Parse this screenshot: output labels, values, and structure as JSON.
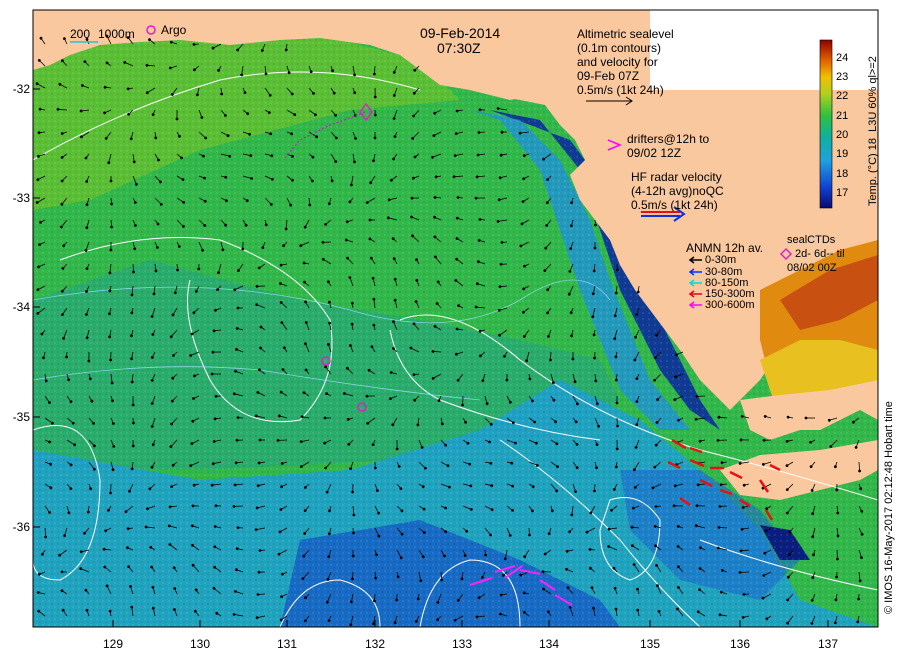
{
  "header": {
    "date": "09-Feb-2014",
    "time": "07:30Z"
  },
  "scale_bar": {
    "label_200": "200",
    "label_1000": "1000m",
    "argo_label": "Argo"
  },
  "altimetry_legend": [
    "Altimetric sealevel",
    "(0.1m contours)",
    "and velocity for",
    "09-Feb 07Z",
    "0.5m/s (1kt 24h)"
  ],
  "drifter_legend": [
    "drifters@12h to",
    "09/02 12Z"
  ],
  "hf_legend": [
    "HF radar velocity",
    "(4-12h avg)noQC",
    "0.5m/s (1kt 24h)"
  ],
  "anmn_legend": {
    "title": "ANMN 12h av.",
    "items": [
      {
        "label": "0-30m",
        "color": "#000000"
      },
      {
        "label": "30-80m",
        "color": "#0030ff"
      },
      {
        "label": "80-150m",
        "color": "#00d8e8"
      },
      {
        "label": "150-300m",
        "color": "#e8001a"
      },
      {
        "label": "300-600m",
        "color": "#ff00ff"
      }
    ]
  },
  "sealctd_legend": [
    "sealCTDs",
    "2d- 6d-- til",
    "08/02 00Z"
  ],
  "colorbar": {
    "title": "Temp. (°C) 18_L3U 60% ql>=2",
    "ticks": [
      "24",
      "23",
      "22",
      "21",
      "20",
      "19",
      "18",
      "17"
    ]
  },
  "axes": {
    "y_ticks": [
      "-32",
      "-33",
      "-34",
      "-35",
      "-36"
    ],
    "x_ticks": [
      "129",
      "130",
      "131",
      "132",
      "133",
      "134",
      "135",
      "136",
      "137"
    ]
  },
  "credit": "© IMOS 16-May-2017 02:12:48 Hobart time",
  "colors": {
    "land": "#f9c89e",
    "sea_warm": "#34c13a",
    "sea_mid": "#21a87c",
    "sea_cool": "#1fa6d6",
    "sea_cold": "#1050c8",
    "coastal_cold": "#0a2a9a",
    "contour": "#ffffff",
    "argo": "#e020c8"
  }
}
